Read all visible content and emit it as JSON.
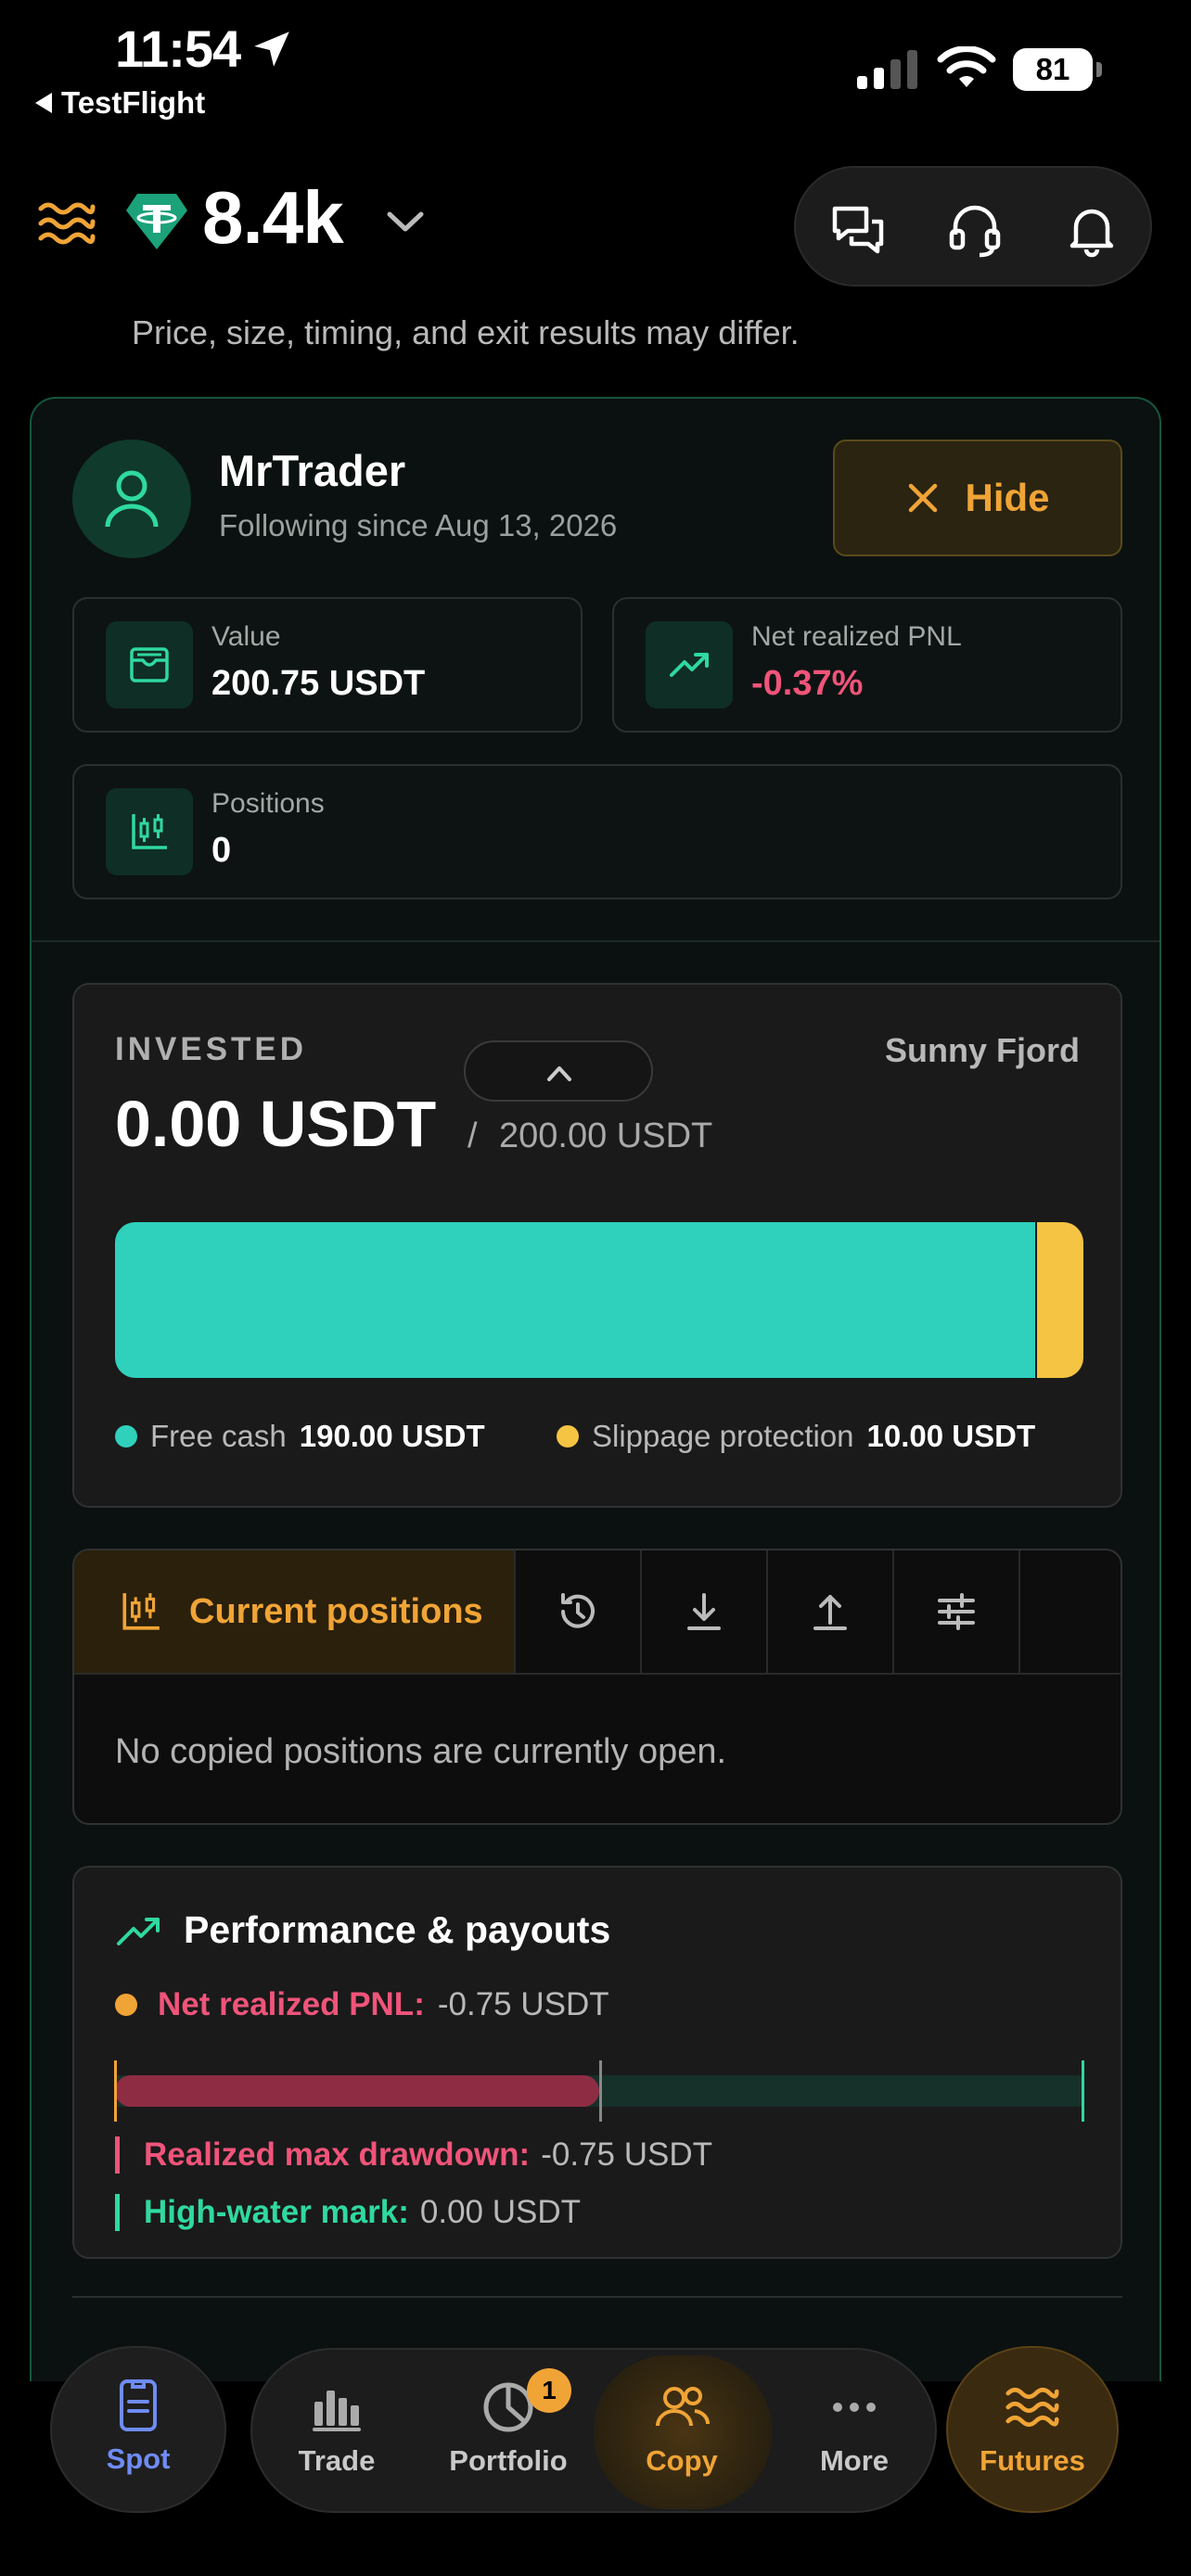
{
  "status_bar": {
    "time": "11:54",
    "back_app": "TestFlight",
    "battery": "81"
  },
  "header": {
    "balance": "8.4k"
  },
  "disclaimer": "Price, size, timing, and exit results may differ.",
  "trader": {
    "name": "MrTrader",
    "following_since": "Following since Aug 13, 2026",
    "hide_label": "Hide"
  },
  "stats": {
    "value_label": "Value",
    "value": "200.75 USDT",
    "pnl_label": "Net realized PNL",
    "pnl": "-0.37%",
    "positions_label": "Positions",
    "positions": "0"
  },
  "invested": {
    "label": "INVESTED",
    "owner": "Sunny Fjord",
    "amount": "0.00 USDT",
    "slash": "/",
    "total": "200.00 USDT",
    "free_cash_label": "Free cash",
    "free_cash": "190.00 USDT",
    "free_cash_value": 190,
    "slippage_label": "Slippage protection",
    "slippage": "10.00 USDT",
    "slippage_value": 10,
    "colors": {
      "free_cash": "#2fd1bd",
      "slippage": "#f5c443"
    }
  },
  "positions_tabs": {
    "active_label": "Current positions",
    "icons": [
      "history-icon",
      "download-icon",
      "upload-icon",
      "sliders-icon"
    ],
    "empty_message": "No copied positions are currently open."
  },
  "performance": {
    "title": "Performance & payouts",
    "pnl_label": "Net realized PNL:",
    "pnl_value": "-0.75 USDT",
    "drawdown_label": "Realized max drawdown:",
    "drawdown_value": "-0.75 USDT",
    "hwm_label": "High-water mark:",
    "hwm_value": "0.00 USDT",
    "drawdown_fraction": 0.5,
    "colors": {
      "negative": "#f0547a",
      "positive": "#2fd9a0",
      "accent": "#f0a436"
    }
  },
  "nav": {
    "spot": "Spot",
    "trade": "Trade",
    "portfolio": "Portfolio",
    "portfolio_badge": "1",
    "copy": "Copy",
    "more": "More",
    "futures": "Futures"
  }
}
